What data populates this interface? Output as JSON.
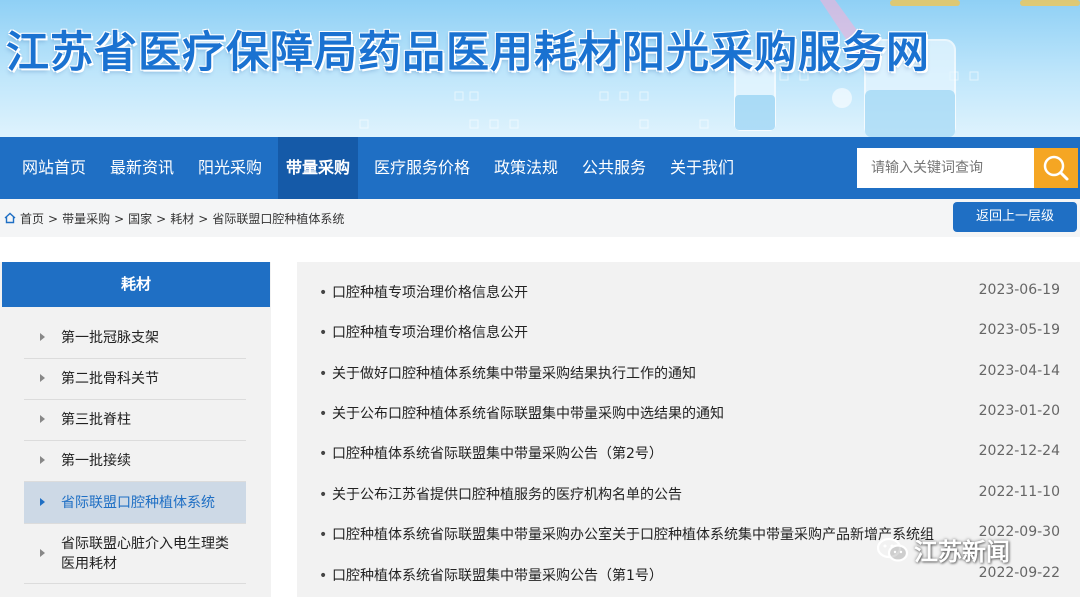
{
  "banner": {
    "title": "江苏省医疗保障局药品医用耗材阳光采购服务网"
  },
  "nav": {
    "items": [
      {
        "label": "网站首页"
      },
      {
        "label": "最新资讯"
      },
      {
        "label": "阳光采购"
      },
      {
        "label": "带量采购",
        "active": true
      },
      {
        "label": "医疗服务价格"
      },
      {
        "label": "政策法规"
      },
      {
        "label": "公共服务"
      },
      {
        "label": "关于我们"
      }
    ],
    "search_placeholder": "请输入关键词查询"
  },
  "breadcrumb": {
    "items": [
      "首页",
      "带量采购",
      "国家",
      "耗材",
      "省际联盟口腔种植体系统"
    ],
    "separator": ">",
    "back_label": "返回上一层级"
  },
  "sidebar": {
    "heading": "耗材",
    "items": [
      {
        "label": "第一批冠脉支架"
      },
      {
        "label": "第二批骨科关节"
      },
      {
        "label": "第三批脊柱"
      },
      {
        "label": "第一批接续"
      },
      {
        "label": "省际联盟口腔种植体系统",
        "active": true
      },
      {
        "label": "省际联盟心脏介入电生理类医用耗材"
      }
    ]
  },
  "list": {
    "bullet": "•",
    "items": [
      {
        "title": "口腔种植专项治理价格信息公开",
        "date": "2023-06-19"
      },
      {
        "title": "口腔种植专项治理价格信息公开",
        "date": "2023-05-19"
      },
      {
        "title": "关于做好口腔种植体系统集中带量采购结果执行工作的通知",
        "date": "2023-04-14"
      },
      {
        "title": "关于公布口腔种植体系统省际联盟集中带量采购中选结果的通知",
        "date": "2023-01-20"
      },
      {
        "title": "口腔种植体系统省际联盟集中带量采购公告（第2号）",
        "date": "2022-12-24"
      },
      {
        "title": "关于公布江苏省提供口腔种植服务的医疗机构名单的公告",
        "date": "2022-11-10"
      },
      {
        "title": "口腔种植体系统省际联盟集中带量采购办公室关于口腔种植体系统集中带量采购产品新增产系统组",
        "date": "2022-09-30"
      },
      {
        "title": "口腔种植体系统省际联盟集中带量采购公告（第1号）",
        "date": "2022-09-22"
      }
    ]
  },
  "watermark": {
    "text": "江苏新闻"
  },
  "colors": {
    "primary": "#1f6fc4",
    "active_nav": "#155aa8",
    "search_button": "#f5a623",
    "panel_bg": "#f2f2f2"
  }
}
